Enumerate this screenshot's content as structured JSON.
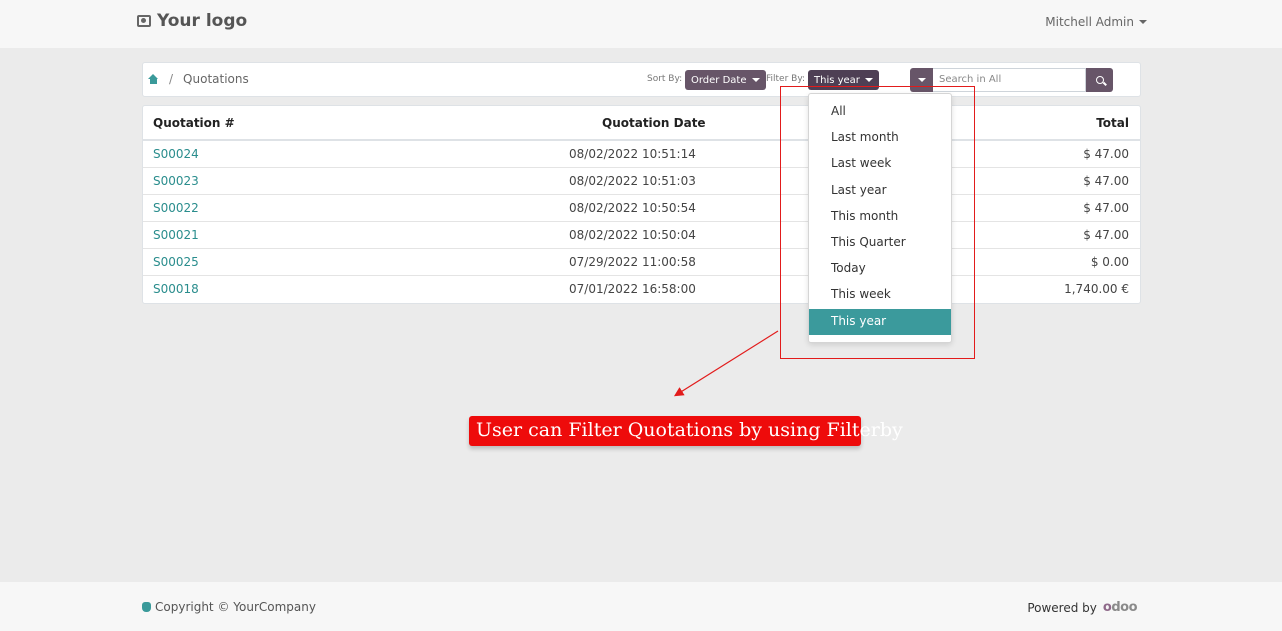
{
  "header": {
    "logo_text": "Your logo",
    "user_name": "Mitchell Admin"
  },
  "toolbar": {
    "breadcrumb_separator": "/",
    "breadcrumb_current": "Quotations",
    "sort_label": "Sort By:",
    "sort_value": "Order Date",
    "filter_label": "Filter By:",
    "filter_value": "This year",
    "search_placeholder": "Search in All"
  },
  "table": {
    "columns": [
      "Quotation #",
      "Quotation Date",
      "Total"
    ],
    "rows": [
      {
        "number": "S00024",
        "date": "08/02/2022 10:51:14",
        "total": "$ 47.00"
      },
      {
        "number": "S00023",
        "date": "08/02/2022 10:51:03",
        "total": "$ 47.00"
      },
      {
        "number": "S00022",
        "date": "08/02/2022 10:50:54",
        "total": "$ 47.00"
      },
      {
        "number": "S00021",
        "date": "08/02/2022 10:50:04",
        "total": "$ 47.00"
      },
      {
        "number": "S00025",
        "date": "07/29/2022 11:00:58",
        "total": "$ 0.00"
      },
      {
        "number": "S00018",
        "date": "07/01/2022 16:58:00",
        "total": "1,740.00 €"
      }
    ]
  },
  "filter_dropdown": {
    "items": [
      "All",
      "Last month",
      "Last week",
      "Last year",
      "This month",
      "This Quarter",
      "Today",
      "This week",
      "This year"
    ],
    "selected_index": 8
  },
  "annotation": {
    "text": "User can Filter Quotations by using Filterby",
    "color": "#ee0b0b"
  },
  "footer": {
    "copyright": "Copyright © YourCompany",
    "powered_by": "Powered by",
    "brand": "odoo"
  },
  "colors": {
    "accent": "#3b9a9c",
    "button": "#675568",
    "link": "#2a8d8d"
  }
}
